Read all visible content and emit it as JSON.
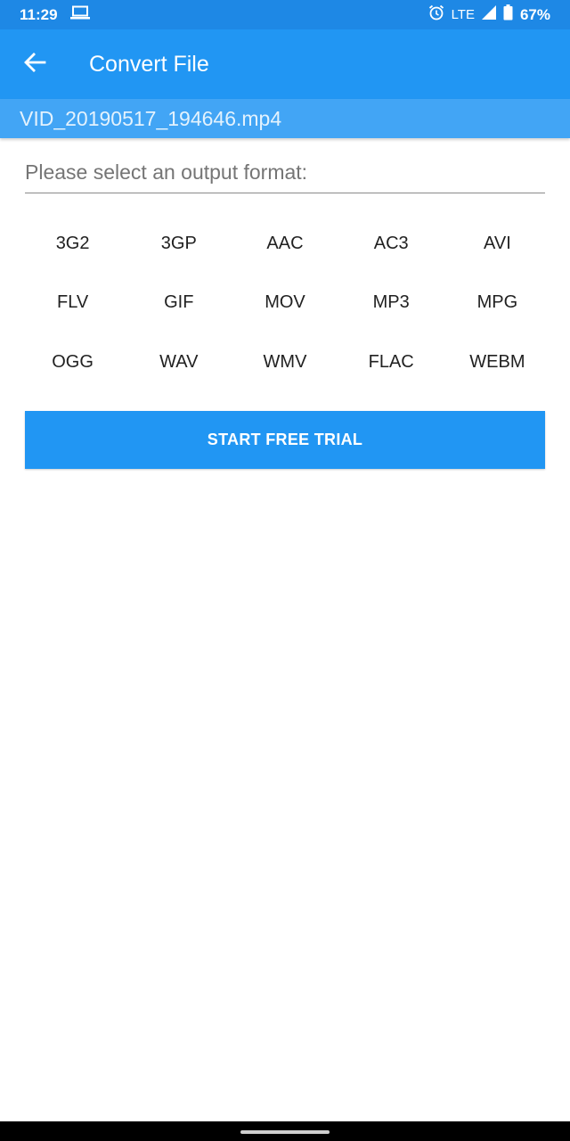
{
  "status_bar": {
    "time": "11:29",
    "network": "LTE",
    "battery": "67%",
    "icons": [
      "laptop-icon",
      "alarm-icon",
      "signal-icon",
      "battery-icon"
    ]
  },
  "app_bar": {
    "title": "Convert File",
    "back_icon": "arrow-left-icon"
  },
  "file": {
    "name": "VID_20190517_194646.mp4"
  },
  "format_select": {
    "prompt": "Please select an output format:",
    "options": [
      "3G2",
      "3GP",
      "AAC",
      "AC3",
      "AVI",
      "FLV",
      "GIF",
      "MOV",
      "MP3",
      "MPG",
      "OGG",
      "WAV",
      "WMV",
      "FLAC",
      "WEBM"
    ]
  },
  "trial_button": {
    "label": "START FREE TRIAL"
  },
  "colors": {
    "status_bar": "#1e88e5",
    "app_bar": "#2196f3",
    "file_strip": "#42a5f5",
    "accent": "#2196f3"
  }
}
